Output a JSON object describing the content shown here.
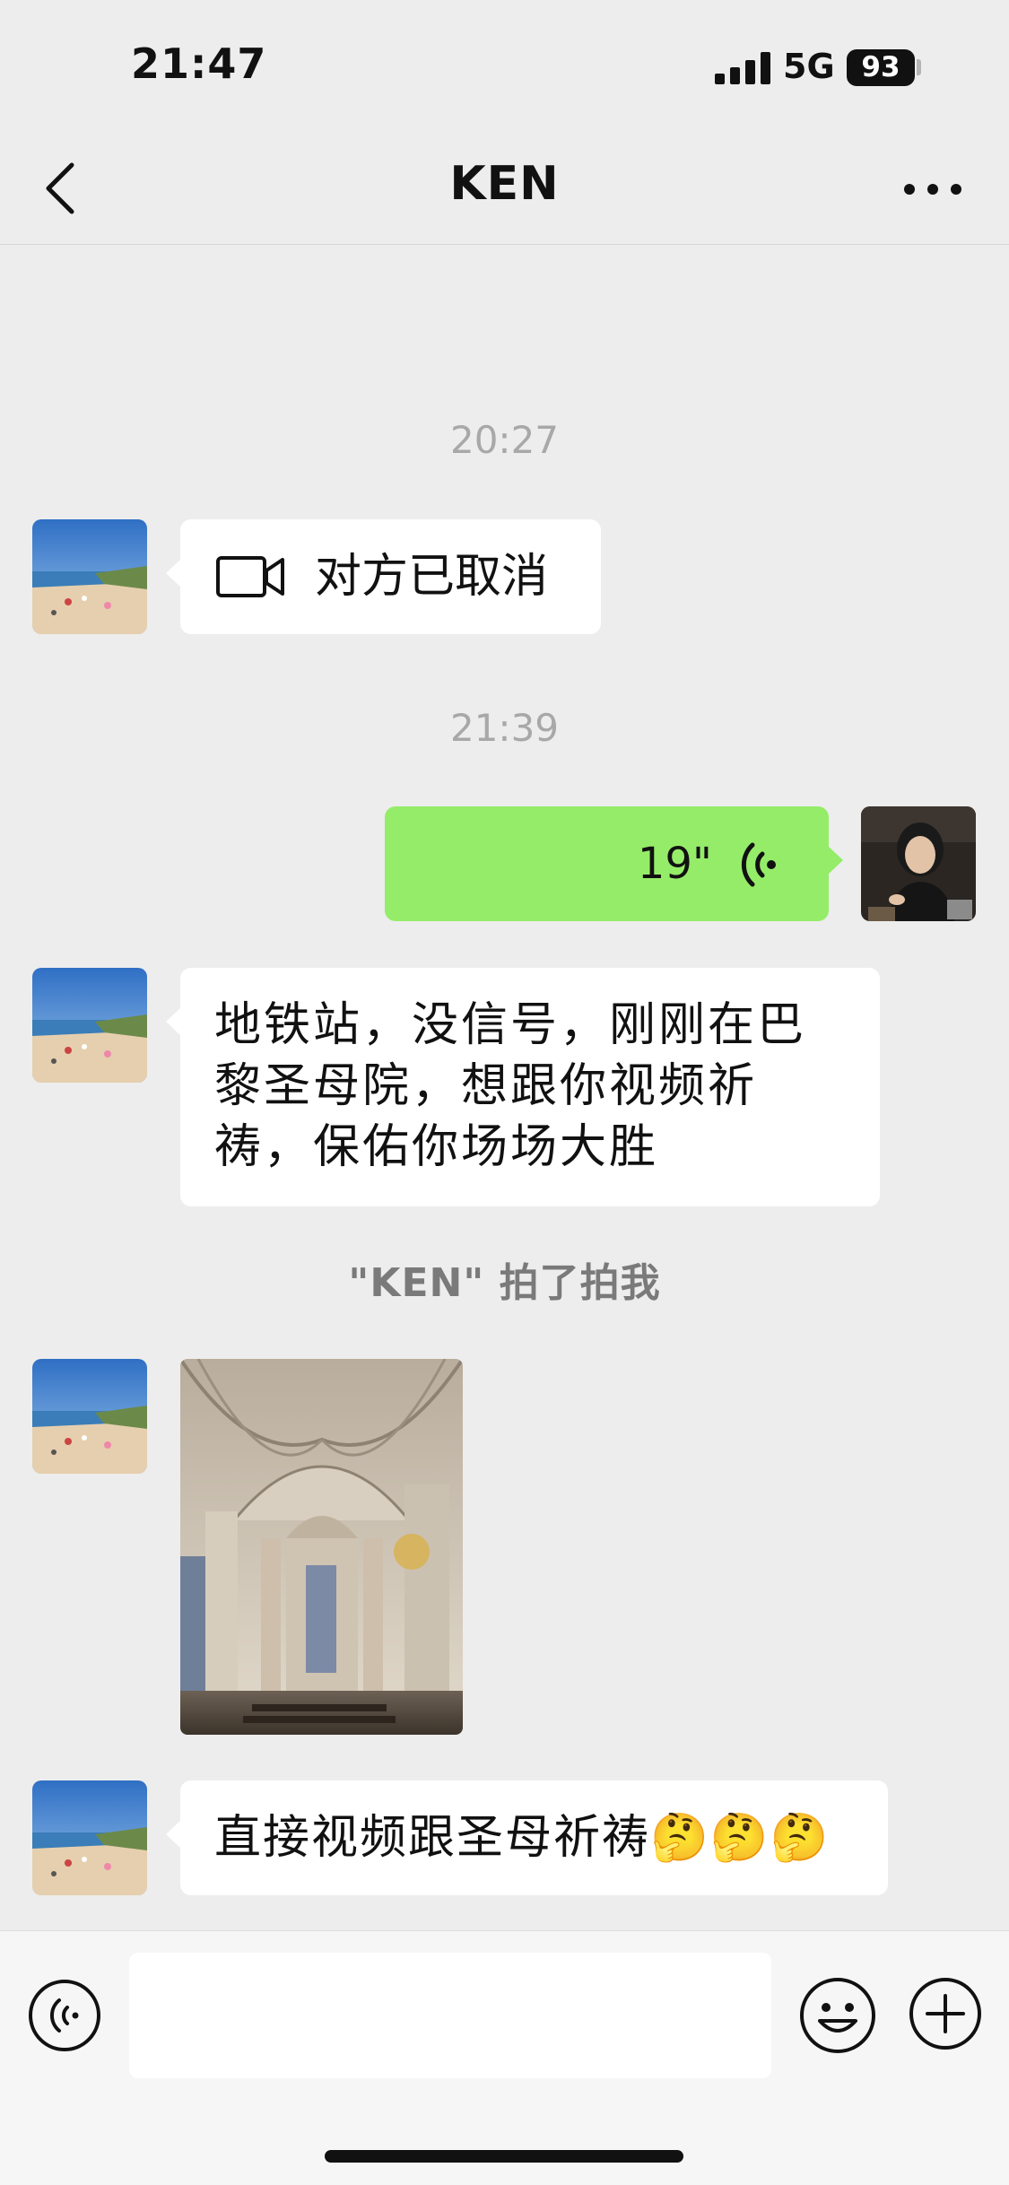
{
  "status_bar": {
    "time": "21:47",
    "network": "5G",
    "battery": "93"
  },
  "nav": {
    "title": "KEN"
  },
  "messages": {
    "time_1": "20:27",
    "video_call": {
      "icon": "video-camera-icon",
      "text": "对方已取消"
    },
    "time_2": "21:39",
    "voice": {
      "duration": "19\""
    },
    "text_1": "地铁站，没信号，刚刚在巴黎圣母院，想跟你视频祈祷，保佑你场场大胜",
    "pat_note": "\"KEN\" 拍了拍我",
    "text_2": "直接视频跟圣母祈祷🤔🤔🤔"
  },
  "colors": {
    "background": "#ededed",
    "sent_bubble": "#95ec69",
    "received_bubble": "#ffffff"
  },
  "input": {
    "placeholder": ""
  }
}
